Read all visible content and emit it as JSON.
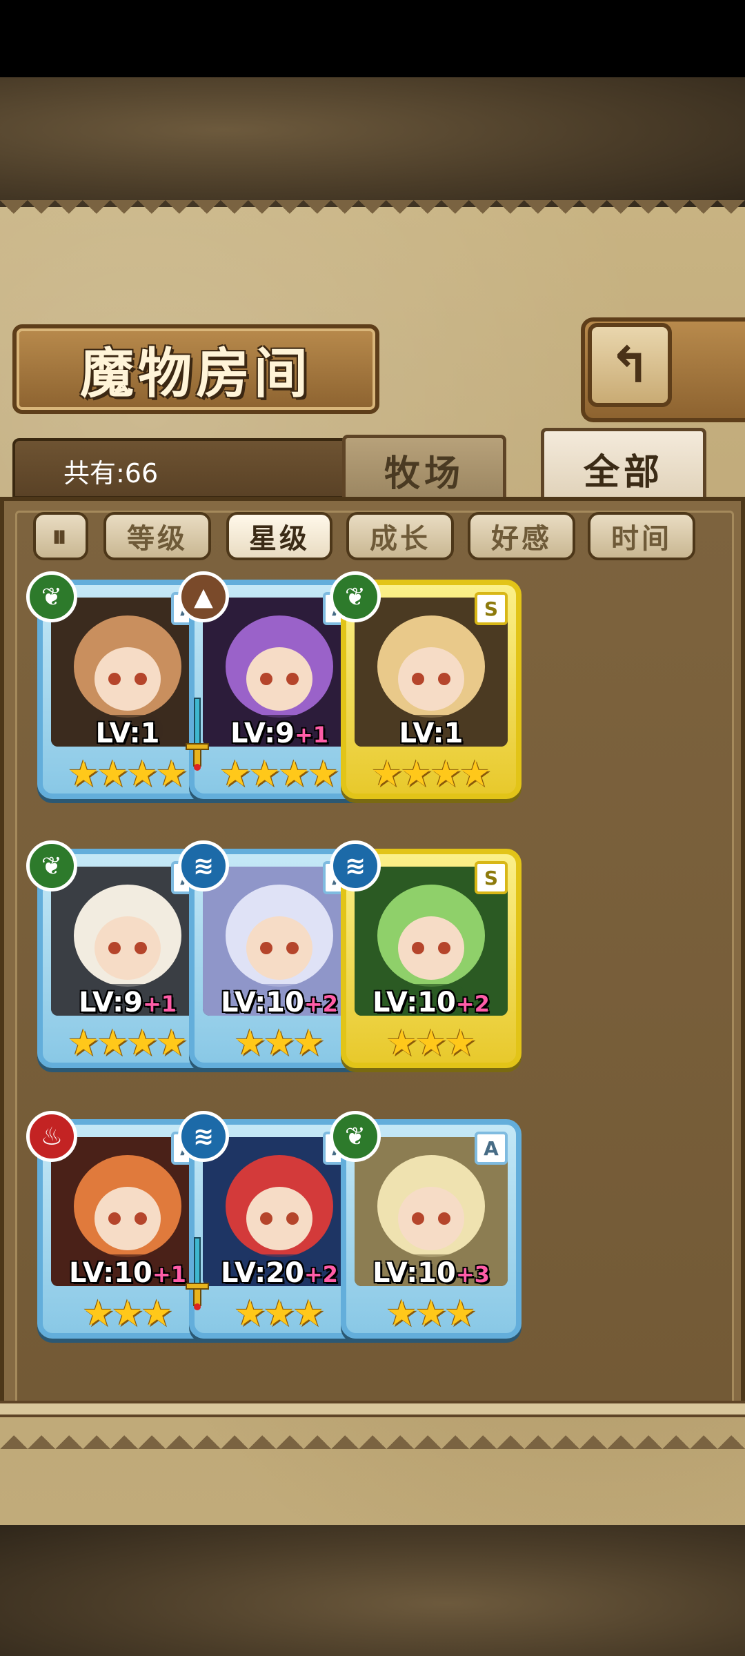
{
  "title": "魔物房间",
  "back_icon": "↰",
  "count_label": "共有:66",
  "tabs": {
    "ranch": "牧场",
    "all": "全部"
  },
  "sort_icon": "⏸",
  "filters": [
    "等级",
    "星级",
    "成长",
    "好感",
    "时间"
  ],
  "active_filter": "星级",
  "colors": {
    "card_blue": "#63aedb",
    "card_gold": "#e2c418",
    "plus_pink": "#ff5da8",
    "star": "#ffc81a"
  },
  "cards": [
    {
      "element": "grass",
      "rank": "A",
      "level": "LV:1",
      "plus": "",
      "stars": "★★★★",
      "gold": false,
      "weapon": false
    },
    {
      "element": "earth",
      "rank": "A",
      "level": "LV:9",
      "plus": "+1",
      "stars": "★★★★",
      "gold": false,
      "weapon": true
    },
    {
      "element": "grass",
      "rank": "S",
      "level": "LV:1",
      "plus": "",
      "stars": "★★★★",
      "gold": true,
      "weapon": false
    },
    {
      "element": "grass",
      "rank": "A",
      "level": "LV:9",
      "plus": "+1",
      "stars": "★★★★",
      "gold": false,
      "weapon": false
    },
    {
      "element": "water",
      "rank": "A",
      "level": "LV:10",
      "plus": "+2",
      "stars": "★★★",
      "gold": false,
      "weapon": false
    },
    {
      "element": "water",
      "rank": "S",
      "level": "LV:10",
      "plus": "+2",
      "stars": "★★★",
      "gold": true,
      "weapon": false
    },
    {
      "element": "fire",
      "rank": "A",
      "level": "LV:10",
      "plus": "+1",
      "stars": "★★★",
      "gold": false,
      "weapon": false
    },
    {
      "element": "water",
      "rank": "A",
      "level": "LV:20",
      "plus": "+2",
      "stars": "★★★",
      "gold": false,
      "weapon": true
    },
    {
      "element": "grass",
      "rank": "A",
      "level": "LV:10",
      "plus": "+3",
      "stars": "★★★",
      "gold": false,
      "weapon": false
    }
  ]
}
